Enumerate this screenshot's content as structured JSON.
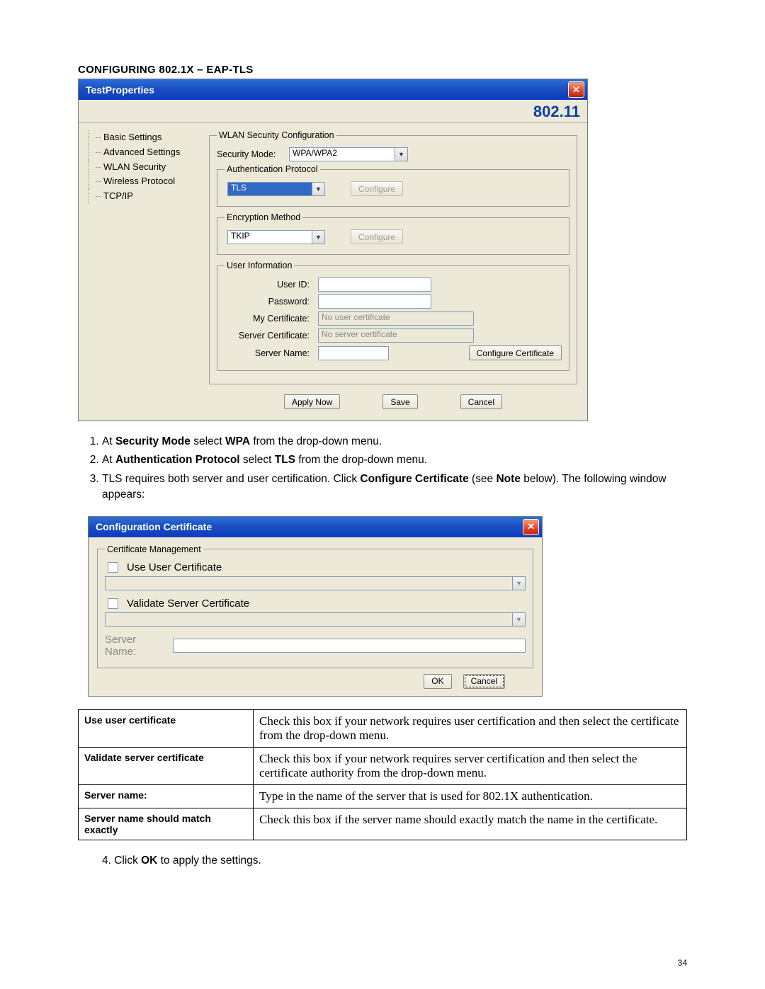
{
  "heading": "CONFIGURING 802.1X – EAP-TLS",
  "page_number": "34",
  "win1": {
    "title": "TestProperties",
    "brand": "802.11",
    "tree": [
      "Basic Settings",
      "Advanced Settings",
      "WLAN Security",
      "Wireless Protocol",
      "TCP/IP"
    ],
    "grp_wlan": "WLAN Security Configuration",
    "lbl_secmode": "Security Mode:",
    "val_secmode": "WPA/WPA2",
    "grp_auth": "Authentication Protocol",
    "val_auth": "TLS",
    "btn_configure": "Configure",
    "grp_enc": "Encryption Method",
    "val_enc": "TKIP",
    "grp_user": "User Information",
    "lbl_userid": "User ID:",
    "lbl_password": "Password:",
    "lbl_mycert": "My Certificate:",
    "val_mycert": "No user certificate",
    "lbl_srvcert": "Server Certificate:",
    "val_srvcert": "No server certificate",
    "lbl_srvname": "Server Name:",
    "btn_configcert": "Configure Certificate",
    "btn_apply": "Apply Now",
    "btn_save": "Save",
    "btn_cancel": "Cancel"
  },
  "steps": {
    "s1a": "At ",
    "s1b": "Security Mode",
    "s1c": " select ",
    "s1d": "WPA",
    "s1e": " from the drop-down menu.",
    "s2a": "At ",
    "s2b": "Authentication Protocol",
    "s2c": " select ",
    "s2d": "TLS",
    "s2e": " from the drop-down menu.",
    "s3a": "TLS requires both server and user certification. Click ",
    "s3b": "Configure Certificate",
    "s3c": " (see ",
    "s3d": "Note",
    "s3e": " below). The following window appears:",
    "s4a": "Click ",
    "s4b": "OK",
    "s4c": " to apply the settings.",
    "s4num": "4.  "
  },
  "win2": {
    "title": "Configuration Certificate",
    "grp": "Certificate Management",
    "chk_user": "Use User Certificate",
    "chk_srv": "Validate Server Certificate",
    "lbl_srvname": "Server Name:",
    "btn_ok": "OK",
    "btn_cancel": "Cancel"
  },
  "table": {
    "r1l": "Use user certificate",
    "r1r": "Check this box if your network requires user certification and then select the certificate from the drop-down menu.",
    "r2l": "Validate server certificate",
    "r2r": "Check this box if your network requires server certification and then select the certificate authority from the drop-down menu.",
    "r3l": "Server name:",
    "r3r": "Type in the name of the server that is used for 802.1X authentication.",
    "r4l": "Server name should match exactly",
    "r4r": "Check this box if the server name should exactly match the name in the certificate."
  }
}
